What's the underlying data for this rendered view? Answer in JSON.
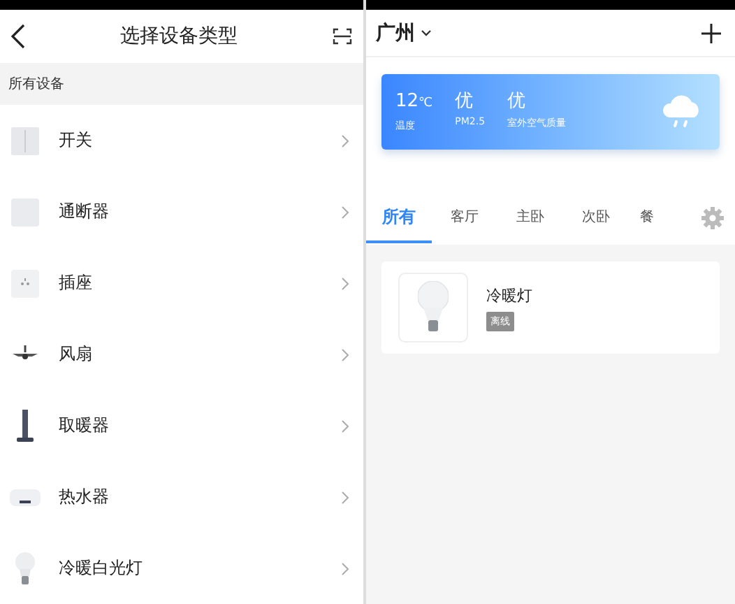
{
  "left": {
    "title": "选择设备类型",
    "section": "所有设备",
    "devices": [
      {
        "name": "开关",
        "kind": "switch"
      },
      {
        "name": "通断器",
        "kind": "breaker"
      },
      {
        "name": "插座",
        "kind": "socket"
      },
      {
        "name": "风扇",
        "kind": "fan"
      },
      {
        "name": "取暖器",
        "kind": "heater"
      },
      {
        "name": "热水器",
        "kind": "water-heater"
      },
      {
        "name": "冷暖白光灯",
        "kind": "bulb"
      }
    ]
  },
  "right": {
    "city": "广州",
    "weather": {
      "temperature": "12",
      "unit": "℃",
      "temperature_label": "温度",
      "pm25": "优",
      "pm25_label": "PM2.5",
      "air": "优",
      "air_label": "室外空气质量"
    },
    "tabs": [
      {
        "label": "所有",
        "selected": true
      },
      {
        "label": "客厅",
        "selected": false
      },
      {
        "label": "主卧",
        "selected": false
      },
      {
        "label": "次卧",
        "selected": false
      },
      {
        "label": "餐",
        "selected": false
      }
    ],
    "devices": [
      {
        "name": "冷暖灯",
        "status": "离线"
      }
    ]
  }
}
